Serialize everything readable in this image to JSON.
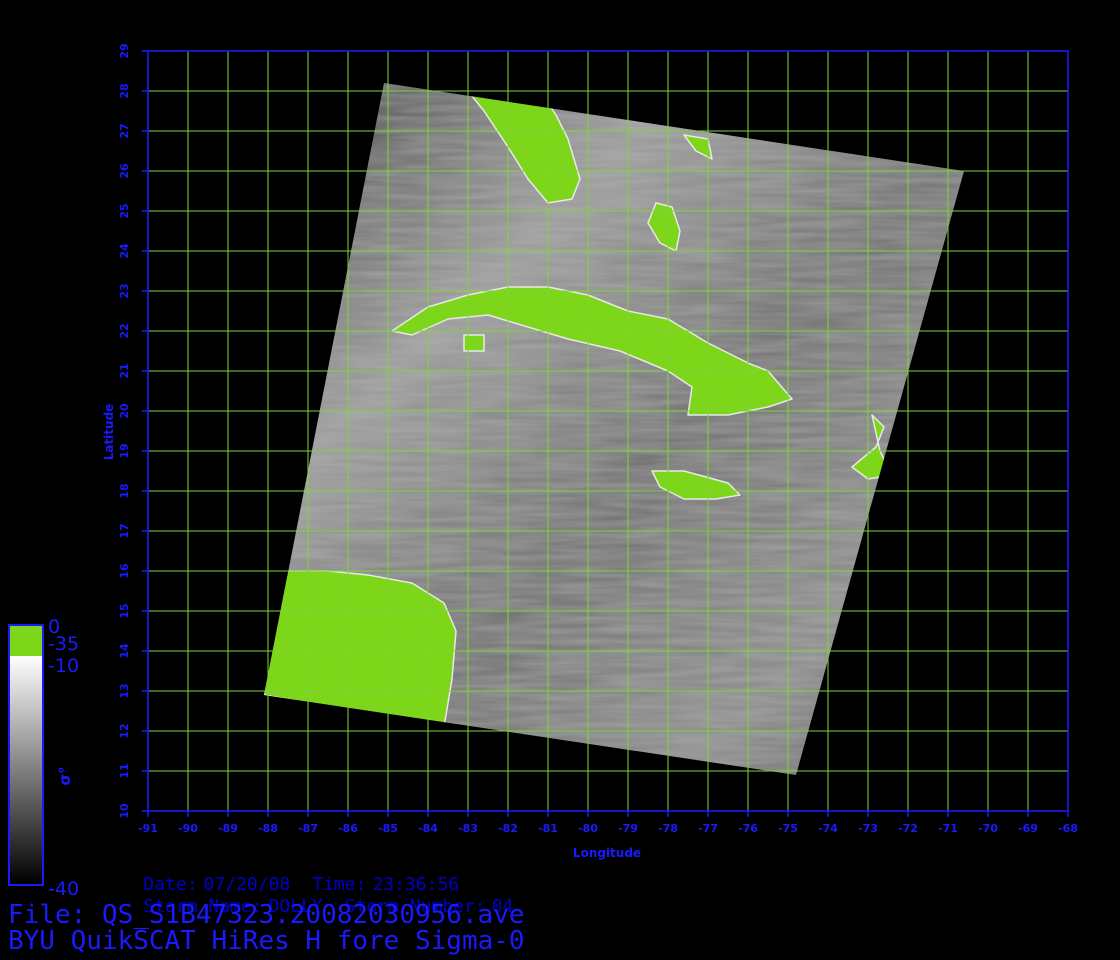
{
  "colors": {
    "background": "#000000",
    "frame": "#1a1aff",
    "grid": "#7fd43a",
    "land": "#7dd61a",
    "text": "#1a1aff",
    "info_text": "#0000c8"
  },
  "map": {
    "x_axis_label": "Longitude",
    "y_axis_label": "Latitude",
    "lon_range": [
      -91,
      -68
    ],
    "lat_range": [
      10,
      29
    ],
    "lon_ticks": [
      -91,
      -90,
      -89,
      -88,
      -87,
      -86,
      -85,
      -84,
      -83,
      -82,
      -81,
      -80,
      -79,
      -78,
      -77,
      -76,
      -75,
      -74,
      -73,
      -72,
      -71,
      -70,
      -69,
      -68
    ],
    "lat_ticks": [
      10,
      11,
      12,
      13,
      14,
      15,
      16,
      17,
      18,
      19,
      20,
      21,
      22,
      23,
      24,
      25,
      26,
      27,
      28,
      29
    ],
    "grid": true,
    "swath_corners_lonlat": [
      [
        -85.1,
        28.2
      ],
      [
        -70.6,
        26.0
      ],
      [
        -74.8,
        10.9
      ],
      [
        -88.1,
        12.9
      ]
    ]
  },
  "colorbar": {
    "green_max_label": "0",
    "green_min_label": "-35",
    "gray_max_label": "-10",
    "gray_min_label": "-40",
    "quantity_label": "σ°",
    "gradient_top": "#ffffff",
    "gradient_bottom": "#000000"
  },
  "info": {
    "date_label": "Date:",
    "date_value": "07/20/08",
    "time_label": "Time:",
    "time_value": "23:36:56",
    "storm_name_label": "Storm Name:",
    "storm_name_value": "DOLLY",
    "storm_number_label": "Storm Number:",
    "storm_number_value": "04"
  },
  "file": {
    "file_line": "File: QS_S1B47323.20082030956.ave",
    "product_line": "BYU QuikSCAT HiRes H fore Sigma-0"
  }
}
